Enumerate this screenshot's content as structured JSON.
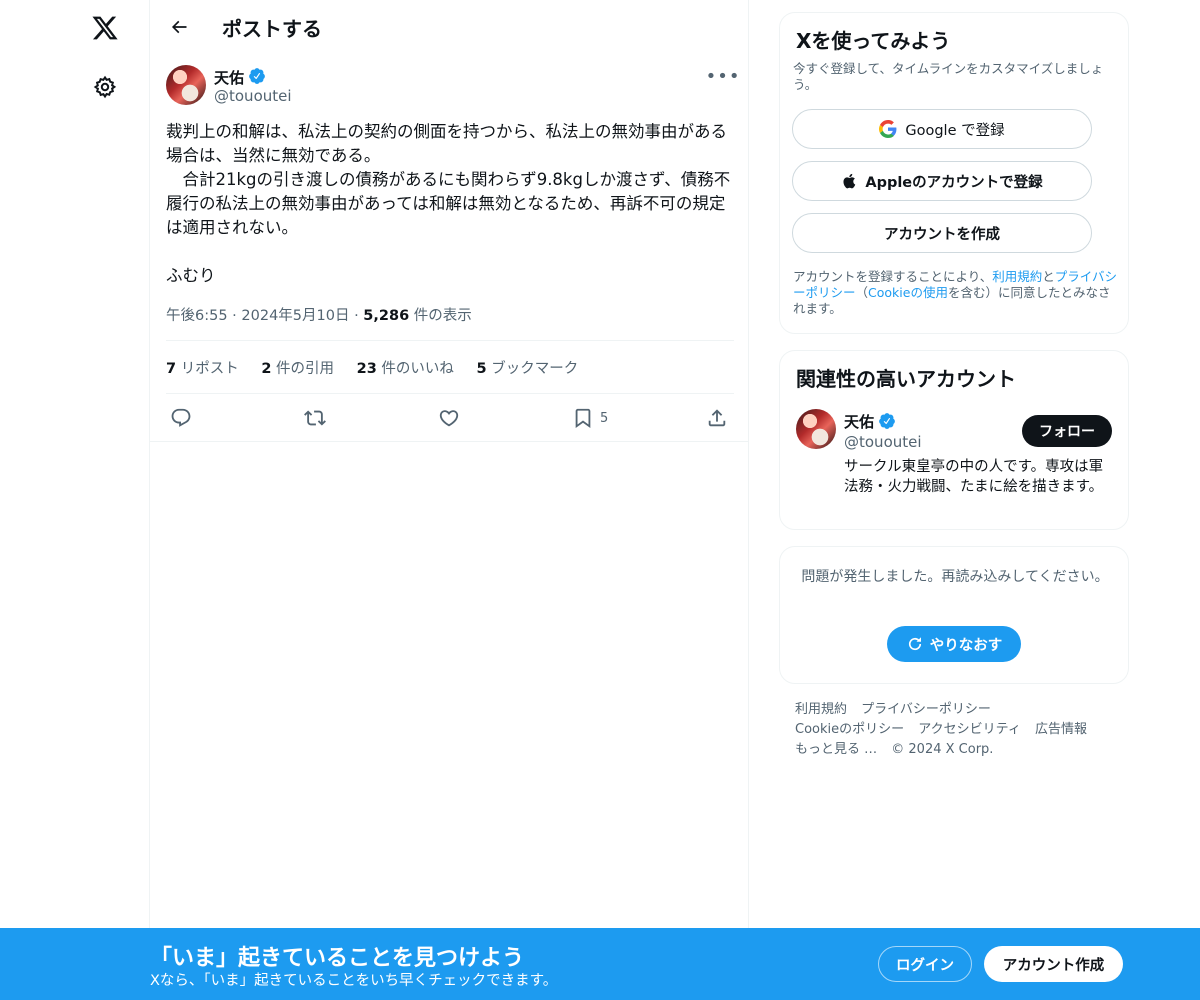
{
  "header": {
    "title": "ポストする"
  },
  "tweet": {
    "author_name": "天佑",
    "author_handle": "@tououtei",
    "text": "裁判上の和解は、私法上の契約の側面を持つから、私法上の無効事由がある場合は、当然に無効である。\n　合計21kgの引き渡しの債務があるにも関わらず9.8kgしか渡さず、債務不履行の私法上の無効事由があっては和解は無効となるため、再訴不可の規定は適用されない。\n\nふむり",
    "time": "午後6:55",
    "sep1": "·",
    "date": "2024年5月10日",
    "sep2": "·",
    "views_count": "5,286",
    "views_label": "件の表示",
    "stats": {
      "reposts_count": "7",
      "reposts_label": "リポスト",
      "quotes_count": "2",
      "quotes_label": "件の引用",
      "likes_count": "23",
      "likes_label": "件のいいね",
      "bookmarks_count": "5",
      "bookmarks_label": "ブックマーク"
    },
    "bookmark_action_count": "5"
  },
  "signup_card": {
    "title": "Xを使ってみよう",
    "subtitle": "今すぐ登録して、タイムラインをカスタマイズしましょう。",
    "google_label": "Google で登録",
    "apple_label": "Appleのアカウントで登録",
    "create_label": "アカウントを作成",
    "legal_prefix": "アカウントを登録することにより、",
    "legal_terms": "利用規約",
    "legal_and": "と",
    "legal_privacy": "プライバシーポリシー",
    "legal_paren_open": "（",
    "legal_cookie": "Cookieの使用",
    "legal_suffix": "を含む）に同意したとみなされます。"
  },
  "related_card": {
    "title": "関連性の高いアカウント",
    "name": "天佑",
    "handle": "@tououtei",
    "follow_label": "フォロー",
    "bio": "サークル東皇亭の中の人です。専攻は軍法務・火力戦闘、たまに絵を描きます。"
  },
  "error_card": {
    "message": "問題が発生しました。再読み込みしてください。",
    "retry_label": "やりなおす"
  },
  "footer": {
    "terms": "利用規約",
    "privacy": "プライバシーポリシー",
    "cookie": "Cookieのポリシー",
    "accessibility": "アクセシビリティ",
    "ads": "広告情報",
    "more": "もっと見る …",
    "copyright": "© 2024 X Corp."
  },
  "banner": {
    "title": "「いま」起きていることを見つけよう",
    "subtitle": "Xなら、「いま」起きていることをいち早くチェックできます。",
    "login_label": "ログイン",
    "signup_label": "アカウント作成"
  },
  "colors": {
    "accent": "#1d9bf0",
    "text": "#0f1419",
    "muted": "#536471",
    "border": "#eff3f4"
  },
  "icons": [
    "x-logo-icon",
    "gear-icon",
    "back-arrow-icon",
    "verified-icon",
    "more-icon",
    "reply-icon",
    "repost-icon",
    "like-icon",
    "bookmark-icon",
    "share-icon",
    "google-icon",
    "apple-icon",
    "refresh-icon"
  ]
}
